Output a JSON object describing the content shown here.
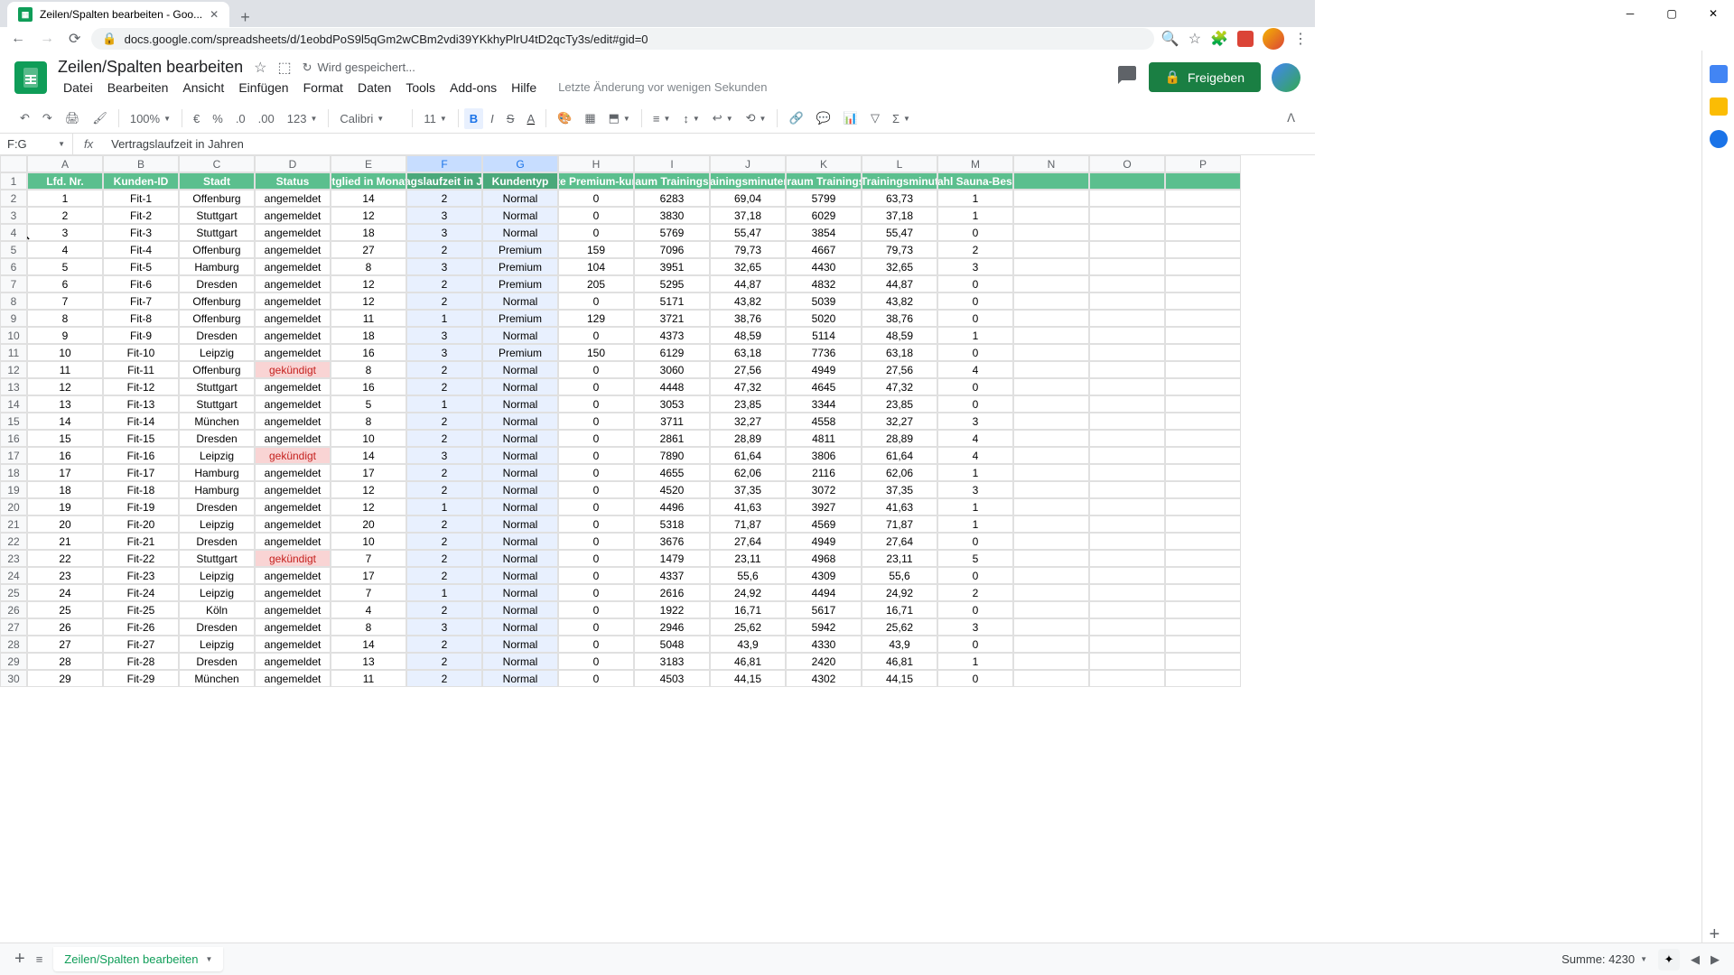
{
  "browser": {
    "tab_title": "Zeilen/Spalten bearbeiten - Goo...",
    "url": "docs.google.com/spreadsheets/d/1eobdPoS9l5qGm2wCBm2vdi39YKkhyPlrU4tD2qcTy3s/edit#gid=0"
  },
  "doc": {
    "title": "Zeilen/Spalten bearbeiten",
    "saving": "Wird gespeichert...",
    "last_edit": "Letzte Änderung vor wenigen Sekunden",
    "share": "Freigeben"
  },
  "menus": [
    "Datei",
    "Bearbeiten",
    "Ansicht",
    "Einfügen",
    "Format",
    "Daten",
    "Tools",
    "Add-ons",
    "Hilfe"
  ],
  "toolbar": {
    "zoom": "100%",
    "currency": "€",
    "percent": "%",
    "dec_dec": ".0",
    "dec_inc": ".00",
    "num_fmt": "123",
    "font": "Calibri",
    "size": "11"
  },
  "name_box": "F:G",
  "formula": "Vertragslaufzeit in Jahren",
  "columns": [
    "A",
    "B",
    "C",
    "D",
    "E",
    "F",
    "G",
    "H",
    "I",
    "J",
    "K",
    "L",
    "M",
    "N",
    "O",
    "P"
  ],
  "selected_cols": [
    "F",
    "G"
  ],
  "headers": [
    "Lfd. Nr.",
    "Kunden-ID",
    "Stadt",
    "Status",
    "itglied in Monat",
    "ragslaufzeit in Ja",
    "Kundentyp",
    "te Premium-kur",
    "aum Trainings",
    "rainingsminuten",
    "rraum Trainings",
    "Trainingsminut",
    "zahl Sauna-Besu"
  ],
  "rows": [
    [
      1,
      "Fit-1",
      "Offenburg",
      "angemeldet",
      14,
      2,
      "Normal",
      0,
      6283,
      "69,04",
      5799,
      "63,73",
      1
    ],
    [
      2,
      "Fit-2",
      "Stuttgart",
      "angemeldet",
      12,
      3,
      "Normal",
      0,
      3830,
      "37,18",
      6029,
      "37,18",
      1
    ],
    [
      3,
      "Fit-3",
      "Stuttgart",
      "angemeldet",
      18,
      3,
      "Normal",
      0,
      5769,
      "55,47",
      3854,
      "55,47",
      0
    ],
    [
      4,
      "Fit-4",
      "Offenburg",
      "angemeldet",
      27,
      2,
      "Premium",
      159,
      7096,
      "79,73",
      4667,
      "79,73",
      2
    ],
    [
      5,
      "Fit-5",
      "Hamburg",
      "angemeldet",
      8,
      3,
      "Premium",
      104,
      3951,
      "32,65",
      4430,
      "32,65",
      3
    ],
    [
      6,
      "Fit-6",
      "Dresden",
      "angemeldet",
      12,
      2,
      "Premium",
      205,
      5295,
      "44,87",
      4832,
      "44,87",
      0
    ],
    [
      7,
      "Fit-7",
      "Offenburg",
      "angemeldet",
      12,
      2,
      "Normal",
      0,
      5171,
      "43,82",
      5039,
      "43,82",
      0
    ],
    [
      8,
      "Fit-8",
      "Offenburg",
      "angemeldet",
      11,
      1,
      "Premium",
      129,
      3721,
      "38,76",
      5020,
      "38,76",
      0
    ],
    [
      9,
      "Fit-9",
      "Dresden",
      "angemeldet",
      18,
      3,
      "Normal",
      0,
      4373,
      "48,59",
      5114,
      "48,59",
      1
    ],
    [
      10,
      "Fit-10",
      "Leipzig",
      "angemeldet",
      16,
      3,
      "Premium",
      150,
      6129,
      "63,18",
      7736,
      "63,18",
      0
    ],
    [
      11,
      "Fit-11",
      "Offenburg",
      "gekündigt",
      8,
      2,
      "Normal",
      0,
      3060,
      "27,56",
      4949,
      "27,56",
      4
    ],
    [
      12,
      "Fit-12",
      "Stuttgart",
      "angemeldet",
      16,
      2,
      "Normal",
      0,
      4448,
      "47,32",
      4645,
      "47,32",
      0
    ],
    [
      13,
      "Fit-13",
      "Stuttgart",
      "angemeldet",
      5,
      1,
      "Normal",
      0,
      3053,
      "23,85",
      3344,
      "23,85",
      0
    ],
    [
      14,
      "Fit-14",
      "München",
      "angemeldet",
      8,
      2,
      "Normal",
      0,
      3711,
      "32,27",
      4558,
      "32,27",
      3
    ],
    [
      15,
      "Fit-15",
      "Dresden",
      "angemeldet",
      10,
      2,
      "Normal",
      0,
      2861,
      "28,89",
      4811,
      "28,89",
      4
    ],
    [
      16,
      "Fit-16",
      "Leipzig",
      "gekündigt",
      14,
      3,
      "Normal",
      0,
      7890,
      "61,64",
      3806,
      "61,64",
      4
    ],
    [
      17,
      "Fit-17",
      "Hamburg",
      "angemeldet",
      17,
      2,
      "Normal",
      0,
      4655,
      "62,06",
      2116,
      "62,06",
      1
    ],
    [
      18,
      "Fit-18",
      "Hamburg",
      "angemeldet",
      12,
      2,
      "Normal",
      0,
      4520,
      "37,35",
      3072,
      "37,35",
      3
    ],
    [
      19,
      "Fit-19",
      "Dresden",
      "angemeldet",
      12,
      1,
      "Normal",
      0,
      4496,
      "41,63",
      3927,
      "41,63",
      1
    ],
    [
      20,
      "Fit-20",
      "Leipzig",
      "angemeldet",
      20,
      2,
      "Normal",
      0,
      5318,
      "71,87",
      4569,
      "71,87",
      1
    ],
    [
      21,
      "Fit-21",
      "Dresden",
      "angemeldet",
      10,
      2,
      "Normal",
      0,
      3676,
      "27,64",
      4949,
      "27,64",
      0
    ],
    [
      22,
      "Fit-22",
      "Stuttgart",
      "gekündigt",
      7,
      2,
      "Normal",
      0,
      1479,
      "23,11",
      4968,
      "23,11",
      5
    ],
    [
      23,
      "Fit-23",
      "Leipzig",
      "angemeldet",
      17,
      2,
      "Normal",
      0,
      4337,
      "55,6",
      4309,
      "55,6",
      0
    ],
    [
      24,
      "Fit-24",
      "Leipzig",
      "angemeldet",
      7,
      1,
      "Normal",
      0,
      2616,
      "24,92",
      4494,
      "24,92",
      2
    ],
    [
      25,
      "Fit-25",
      "Köln",
      "angemeldet",
      4,
      2,
      "Normal",
      0,
      1922,
      "16,71",
      5617,
      "16,71",
      0
    ],
    [
      26,
      "Fit-26",
      "Dresden",
      "angemeldet",
      8,
      3,
      "Normal",
      0,
      2946,
      "25,62",
      5942,
      "25,62",
      3
    ],
    [
      27,
      "Fit-27",
      "Leipzig",
      "angemeldet",
      14,
      2,
      "Normal",
      0,
      5048,
      "43,9",
      4330,
      "43,9",
      0
    ],
    [
      28,
      "Fit-28",
      "Dresden",
      "angemeldet",
      13,
      2,
      "Normal",
      0,
      3183,
      "46,81",
      2420,
      "46,81",
      1
    ],
    [
      29,
      "Fit-29",
      "München",
      "angemeldet",
      11,
      2,
      "Normal",
      0,
      4503,
      "44,15",
      4302,
      "44,15",
      0
    ]
  ],
  "cancelled_status": "gekündigt",
  "sheet_tab": "Zeilen/Spalten bearbeiten",
  "summary": "Summe: 4230"
}
